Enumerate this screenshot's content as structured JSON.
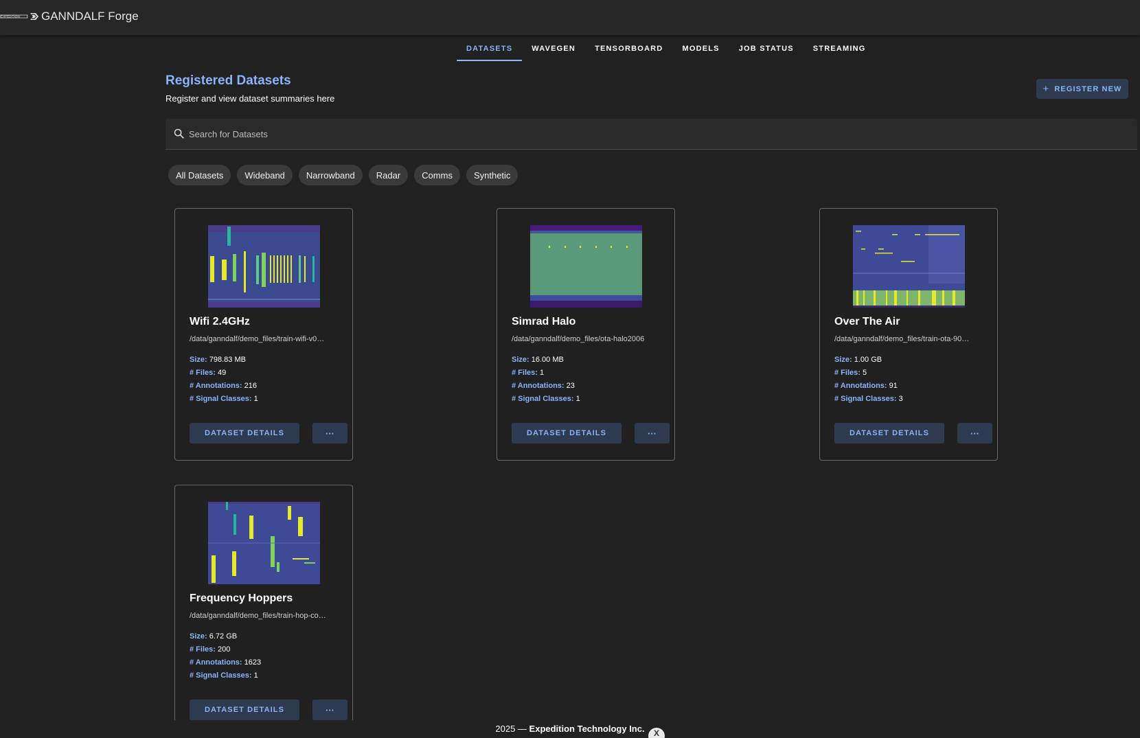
{
  "app": {
    "title": "GANNDALF Forge",
    "logo": "expedition-logo"
  },
  "nav": {
    "tabs": [
      {
        "label": "DATASETS",
        "active": true
      },
      {
        "label": "WAVEGEN"
      },
      {
        "label": "TENSORBOARD"
      },
      {
        "label": "MODELS"
      },
      {
        "label": "JOB STATUS"
      },
      {
        "label": "STREAMING"
      }
    ]
  },
  "header": {
    "title": "Registered Datasets",
    "subtitle": "Register and view dataset summaries here",
    "register_label": "REGISTER NEW",
    "register_icon": "plus-icon"
  },
  "search": {
    "placeholder": "Search for Datasets",
    "icon": "search-icon"
  },
  "filters": [
    "All Datasets",
    "Wideband",
    "Narrowband",
    "Radar",
    "Comms",
    "Synthetic"
  ],
  "labels": {
    "size": "Size:",
    "files": "# Files:",
    "annotations": "# Annotations:",
    "signal_classes": "# Signal Classes:",
    "details": "DATASET DETAILS",
    "more": "···"
  },
  "datasets": [
    {
      "name": "Wifi 2.4GHz",
      "path": "/data/ganndalf/demo_files/train-wifi-v0…",
      "size": "798.83 MB",
      "files": "49",
      "annotations": "216",
      "signal_classes": "1",
      "thumbnail": "wifi-spectrogram"
    },
    {
      "name": "Simrad Halo",
      "path": "/data/ganndalf/demo_files/ota-halo2006",
      "size": "16.00 MB",
      "files": "1",
      "annotations": "23",
      "signal_classes": "1",
      "thumbnail": "halo-spectrogram"
    },
    {
      "name": "Over The Air",
      "path": "/data/ganndalf/demo_files/train-ota-90…",
      "size": "1.00 GB",
      "files": "5",
      "annotations": "91",
      "signal_classes": "3",
      "thumbnail": "ota-spectrogram"
    },
    {
      "name": "Frequency Hoppers",
      "path": "/data/ganndalf/demo_files/train-hop-co…",
      "size": "6.72 GB",
      "files": "200",
      "annotations": "1623",
      "signal_classes": "1",
      "thumbnail": "hopper-spectrogram"
    }
  ],
  "footer": {
    "year": "2025 — ",
    "company": "Expedition Technology Inc.",
    "badge": "X"
  },
  "colors": {
    "accent": "#8ab4f8",
    "background": "#212121",
    "appbar": "#272727",
    "button_bg": "#2e3a4f",
    "spectrogram_bg": "#3b4a8f",
    "spectrogram_signal": "#e6e82c"
  }
}
